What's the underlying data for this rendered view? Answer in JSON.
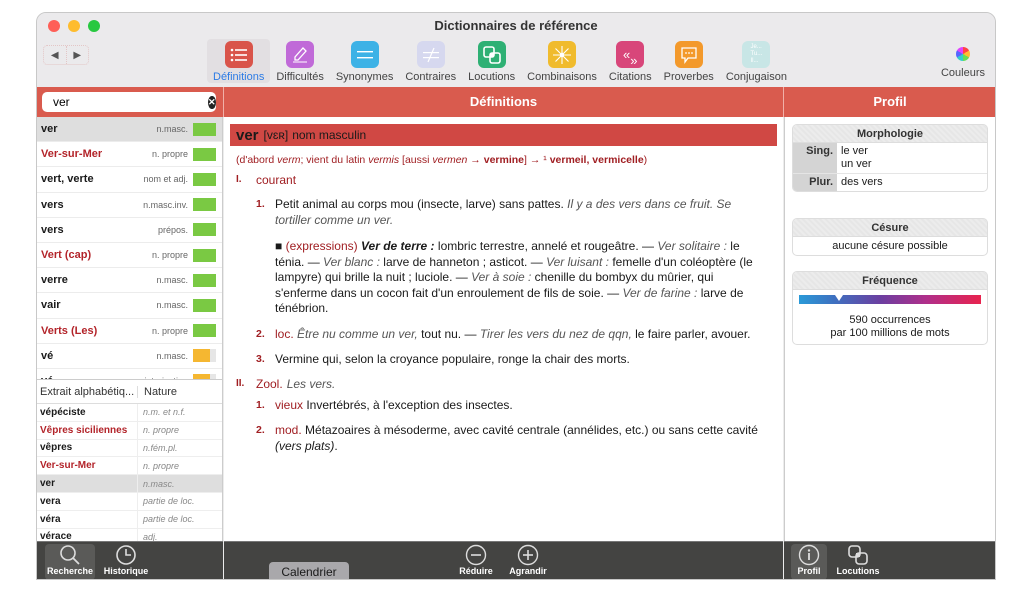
{
  "window": {
    "title": "Dictionnaires de référence"
  },
  "nav": {
    "back_icon": "triangle-left",
    "forward_icon": "triangle-right"
  },
  "toolbar": {
    "tools": [
      {
        "label": "Définitions",
        "icon": "list-icon",
        "color": "#d9544a",
        "active": true
      },
      {
        "label": "Difficultés",
        "icon": "pen-icon",
        "color": "#c06ad8",
        "active": false
      },
      {
        "label": "Synonymes",
        "icon": "equals-icon",
        "color": "#3db2e6",
        "active": false
      },
      {
        "label": "Contraires",
        "icon": "not-equal-icon",
        "color": "#d6d8ef",
        "active": false
      },
      {
        "label": "Locutions",
        "icon": "overlap-squares-icon",
        "color": "#2eb074",
        "active": false
      },
      {
        "label": "Combinaisons",
        "icon": "asterisk-icon",
        "color": "#f0bb2d",
        "active": false
      },
      {
        "label": "Citations",
        "icon": "quotes-icon",
        "color": "#d8467a",
        "active": false
      },
      {
        "label": "Proverbes",
        "icon": "speech-bubble-icon",
        "color": "#f3992b",
        "active": false
      },
      {
        "label": "Conjugaison",
        "icon": "je-tu-il-icon",
        "color": "#c8e6e6",
        "active": false
      }
    ],
    "couleurs_label": "Couleurs"
  },
  "search": {
    "value": "ver",
    "placeholder": ""
  },
  "panes": {
    "definitions_title": "Définitions",
    "profil_title": "Profil"
  },
  "colors": {
    "accent": "#d95b4e",
    "headword_bar": "#d04844",
    "proper_noun": "#b3242a",
    "freq_green": "#7ac943",
    "freq_orange": "#f5b731"
  },
  "results": [
    {
      "word": "ver",
      "nature": "n.masc.",
      "proper": false,
      "freq": 1.0,
      "freq_color": "green",
      "selected": true
    },
    {
      "word": "Ver-sur-Mer",
      "nature": "n. propre",
      "proper": true,
      "freq": 1.0,
      "freq_color": "green",
      "selected": false
    },
    {
      "word": "vert, verte",
      "nature": "nom et adj.",
      "proper": false,
      "freq": 1.0,
      "freq_color": "green",
      "selected": false
    },
    {
      "word": "vers",
      "nature": "n.masc.inv.",
      "proper": false,
      "freq": 1.0,
      "freq_color": "green",
      "selected": false
    },
    {
      "word": "vers",
      "nature": "prépos.",
      "proper": false,
      "freq": 1.0,
      "freq_color": "green",
      "selected": false
    },
    {
      "word": "Vert (cap)",
      "nature": "n. propre",
      "proper": true,
      "freq": 1.0,
      "freq_color": "green",
      "selected": false
    },
    {
      "word": "verre",
      "nature": "n.masc.",
      "proper": false,
      "freq": 1.0,
      "freq_color": "green",
      "selected": false
    },
    {
      "word": "vair",
      "nature": "n.masc.",
      "proper": false,
      "freq": 1.0,
      "freq_color": "green",
      "selected": false
    },
    {
      "word": "Verts (Les)",
      "nature": "n. propre",
      "proper": true,
      "freq": 1.0,
      "freq_color": "green",
      "selected": false
    },
    {
      "word": "vé",
      "nature": "n.masc.",
      "proper": false,
      "freq": 0.75,
      "freq_color": "orange",
      "selected": false
    },
    {
      "word": "vé",
      "nature": "interjection",
      "proper": false,
      "freq": 0.75,
      "freq_color": "orange",
      "selected": false
    }
  ],
  "alpha": {
    "col1": "Extrait alphabétiq...",
    "col2": "Nature",
    "rows": [
      {
        "word": "vépéciste",
        "nature": "n.m. et n.f.",
        "proper": false,
        "selected": false
      },
      {
        "word": "Vêpres siciliennes",
        "nature": "n. propre",
        "proper": true,
        "selected": false
      },
      {
        "word": "vêpres",
        "nature": "n.fém.pl.",
        "proper": false,
        "selected": false
      },
      {
        "word": "Ver-sur-Mer",
        "nature": "n. propre",
        "proper": true,
        "selected": false
      },
      {
        "word": "ver",
        "nature": "n.masc.",
        "proper": false,
        "selected": true
      },
      {
        "word": "vera",
        "nature": "partie de loc.",
        "proper": false,
        "selected": false
      },
      {
        "word": "véra",
        "nature": "partie de loc.",
        "proper": false,
        "selected": false
      },
      {
        "word": "vérace",
        "nature": "adj.",
        "proper": false,
        "selected": false
      }
    ]
  },
  "entry": {
    "headword": "ver",
    "phonetic": "[vɛʀ]",
    "pos": "nom masculin",
    "etym": {
      "p1": "(d'abord ",
      "i1": "verm",
      "p2": "; vient du latin ",
      "i2": "vermis",
      "p3": " [aussi ",
      "i3": "vermen",
      "p4": " → ",
      "b1": "vermine",
      "p5": "] → ¹ ",
      "b2": "vermeil, vermicelle",
      "p6": ")"
    },
    "sec1": {
      "num": "I.",
      "label": "courant"
    },
    "d1": {
      "num": "1.",
      "text": "Petit animal au corps mou (insecte, larve) sans pattes.",
      "ex": "Il y a des vers dans ce fruit. Se tortiller comme un ver."
    },
    "expr": {
      "marker": "■",
      "tag": "(expressions)",
      "e1": "Ver de terre :",
      "t1": " lombric terrestre, annelé et rougeâtre. — ",
      "e2": "Ver solitaire :",
      "t2": " le ténia. — ",
      "e3": "Ver blanc :",
      "t3": " larve de hanneton ; asticot. — ",
      "e4": "Ver luisant :",
      "t4": " femelle d'un coléoptère (le lampyre) qui brille la nuit ; luciole. — ",
      "e5": "Ver à soie :",
      "t5": " chenille du bombyx du mûrier, qui s'enferme dans un cocon fait d'un enroulement de fils de soie. — ",
      "e6": "Ver de farine :",
      "t6": " larve de ténébrion."
    },
    "d2": {
      "num": "2.",
      "tag": "loc.",
      "ex1": "Être nu comme un ver,",
      "t1": " tout nu. — ",
      "ex2": "Tirer les vers du nez de qqn,",
      "t2": " le faire parler, avouer."
    },
    "d3": {
      "num": "3.",
      "text": "Vermine qui, selon la croyance populaire, ronge la chair des morts."
    },
    "sec2": {
      "num": "II.",
      "label": "Zool.",
      "it": "Les vers."
    },
    "d4": {
      "num": "1.",
      "tag": "vieux",
      "text": " Invertébrés, à l'exception des insectes."
    },
    "d5": {
      "num": "2.",
      "tag": "mod.",
      "text": " Métazoaires à mésoderme, avec cavité centrale (annélides, etc.) ou sans cette cavité ",
      "ex": "(vers plats)",
      "end": "."
    }
  },
  "profil": {
    "morph_title": "Morphologie",
    "sing_label": "Sing.",
    "sing_1": "le ver",
    "sing_2": "un ver",
    "plur_label": "Plur.",
    "plur_1": "des vers",
    "cesure_title": "Césure",
    "cesure_value": "aucune césure possible",
    "freq_title": "Fréquence",
    "freq_position": 0.22,
    "freq_line1": "590 occurrences",
    "freq_line2": "par 100 millions de mots"
  },
  "bottom": {
    "recherche": "Recherche",
    "historique": "Historique",
    "calendrier": "Calendrier",
    "reduire": "Réduire",
    "agrandir": "Agrandir",
    "profil": "Profil",
    "locutions": "Locutions"
  }
}
